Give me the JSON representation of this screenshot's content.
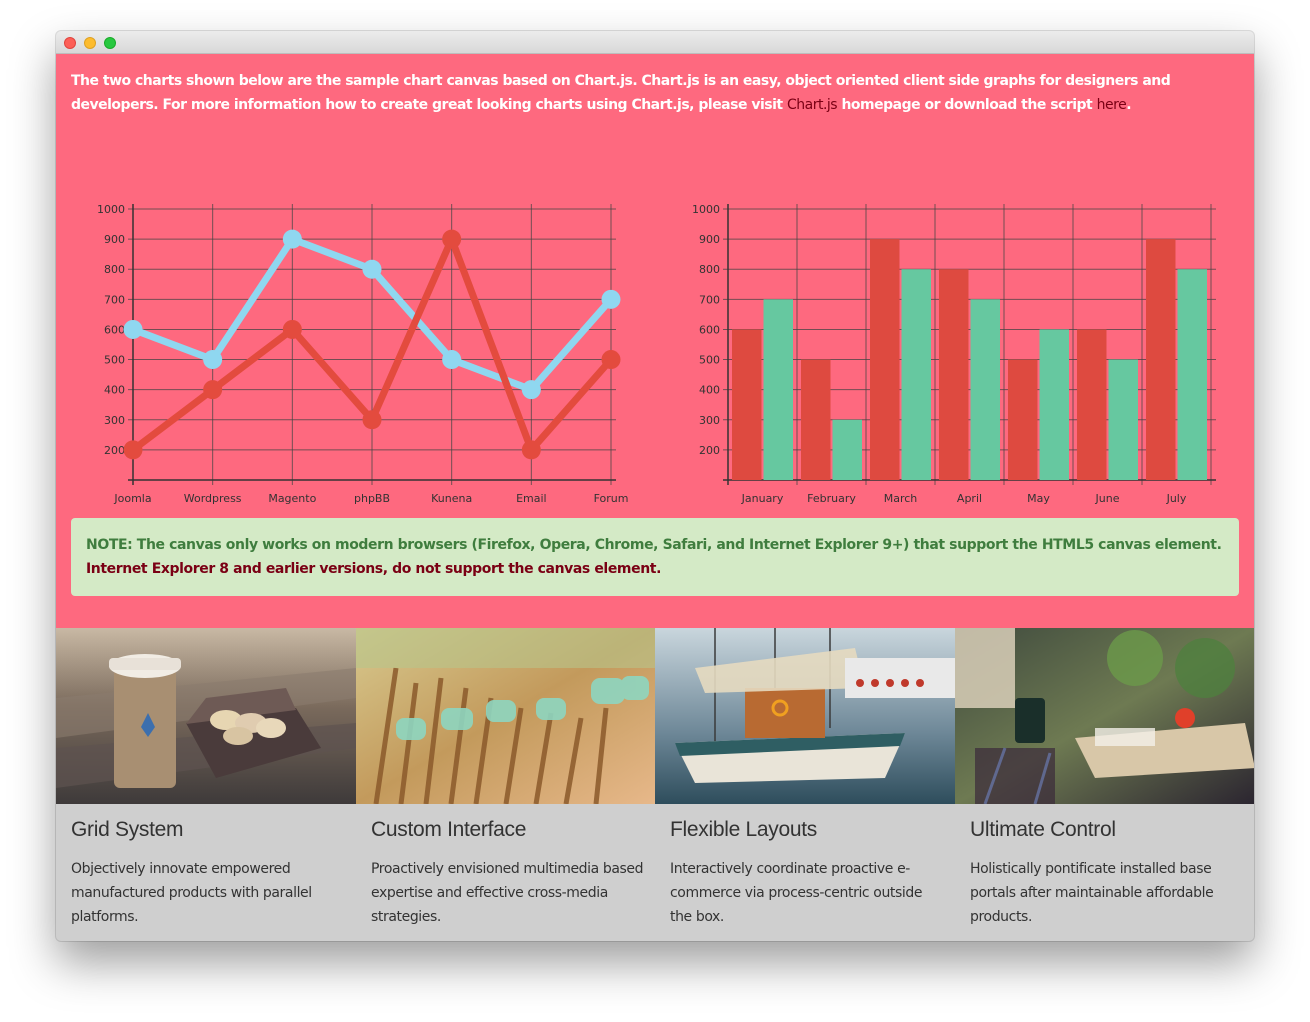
{
  "intro": {
    "text_before": "The two charts shown below are the sample chart canvas based on Chart.js. Chart.js is an easy, object oriented client side graphs for designers and developers. For more information how to create great looking charts using Chart.js, please visit ",
    "link1": "Chart.js",
    "text_middle": " homepage or download the script ",
    "link2": "here",
    "text_after": "."
  },
  "chart_data": [
    {
      "type": "line",
      "categories": [
        "Joomla",
        "Wordpress",
        "Magento",
        "phpBB",
        "Kunena",
        "Email",
        "Forum"
      ],
      "series": [
        {
          "values": [
            600,
            500,
            900,
            800,
            500,
            400,
            700
          ],
          "color": "#8fd7f0"
        },
        {
          "values": [
            200,
            400,
            600,
            300,
            900,
            200,
            500
          ],
          "color": "#e34b3e"
        }
      ],
      "y_ticks": [
        200,
        300,
        400,
        500,
        600,
        700,
        800,
        900,
        1000
      ],
      "ylim": [
        100,
        1000
      ],
      "grid": true
    },
    {
      "type": "bar",
      "categories": [
        "January",
        "February",
        "March",
        "April",
        "May",
        "June",
        "July"
      ],
      "series": [
        {
          "values": [
            600,
            500,
            900,
            800,
            500,
            600,
            900
          ],
          "color": "#de4a40"
        },
        {
          "values": [
            700,
            300,
            800,
            700,
            600,
            500,
            800
          ],
          "color": "#66c8a0"
        }
      ],
      "y_ticks": [
        200,
        300,
        400,
        500,
        600,
        700,
        800,
        900,
        1000
      ],
      "ylim": [
        100,
        1000
      ],
      "grid": true
    }
  ],
  "note": {
    "green_text": "NOTE: The canvas only works on modern browsers (Firefox, Opera, Chrome, Safari, and Internet Explorer 9+) that support the HTML5 canvas element. ",
    "red_text": "Internet Explorer 8 and earlier versions, do not support the canvas element."
  },
  "features": [
    {
      "title": "Grid System",
      "text": "Objectively innovate empowered manufactured products with parallel platforms."
    },
    {
      "title": "Custom Interface",
      "text": "Proactively envisioned multimedia based expertise and effective cross-media strategies."
    },
    {
      "title": "Flexible Layouts",
      "text": "Interactively coordinate proactive e-commerce via process-centric outside the box."
    },
    {
      "title": "Ultimate Control",
      "text": "Holistically pontificate installed base portals after maintainable affordable products."
    }
  ]
}
